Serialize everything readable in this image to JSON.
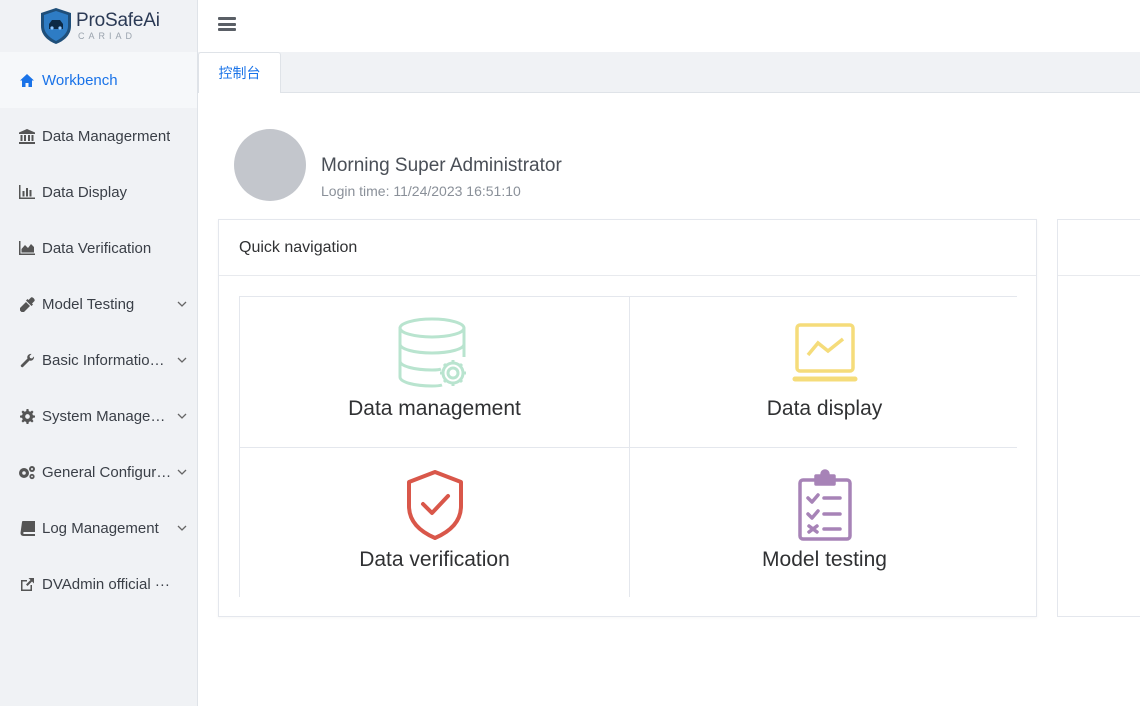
{
  "brand": {
    "name": "ProSafeAi",
    "subname": "CARIAD"
  },
  "sidebar": {
    "items": [
      {
        "label": "Workbench",
        "icon": "home-icon",
        "active": true,
        "expandable": false
      },
      {
        "label": "Data Managerment",
        "icon": "bank-icon",
        "expandable": false
      },
      {
        "label": "Data Display",
        "icon": "bar-chart-icon",
        "expandable": false
      },
      {
        "label": "Data Verification",
        "icon": "area-chart-icon",
        "expandable": false
      },
      {
        "label": "Model Testing",
        "icon": "eyedropper-icon",
        "expandable": true
      },
      {
        "label": "Basic InformationAI",
        "icon": "wrench-icon",
        "expandable": true
      },
      {
        "label": "System Managem···",
        "icon": "gear-icon",
        "expandable": true
      },
      {
        "label": "General Configura···",
        "icon": "gears-icon",
        "expandable": true
      },
      {
        "label": "Log Management",
        "icon": "book-icon",
        "expandable": true
      },
      {
        "label": "DVAdmin official ···",
        "icon": "external-link-icon",
        "expandable": false
      }
    ]
  },
  "tabs": [
    {
      "label": "控制台",
      "active": true
    }
  ],
  "user": {
    "greeting": "Morning Super Administrator",
    "login_time": "Login time: 11/24/2023 16:51:10"
  },
  "quick_nav": {
    "title": "Quick navigation",
    "tiles": [
      {
        "label": "Data management",
        "icon": "database-gear-icon",
        "color": "#b9e4cf"
      },
      {
        "label": "Data display",
        "icon": "monitor-chart-icon",
        "color": "#f5dc7a"
      },
      {
        "label": "Data verification",
        "icon": "shield-check-icon",
        "color": "#d9574a"
      },
      {
        "label": "Model testing",
        "icon": "clipboard-checklist-icon",
        "color": "#a783b7"
      }
    ]
  },
  "colors": {
    "accent": "#1a73e8",
    "sidebar_bg": "#f0f2f5"
  }
}
